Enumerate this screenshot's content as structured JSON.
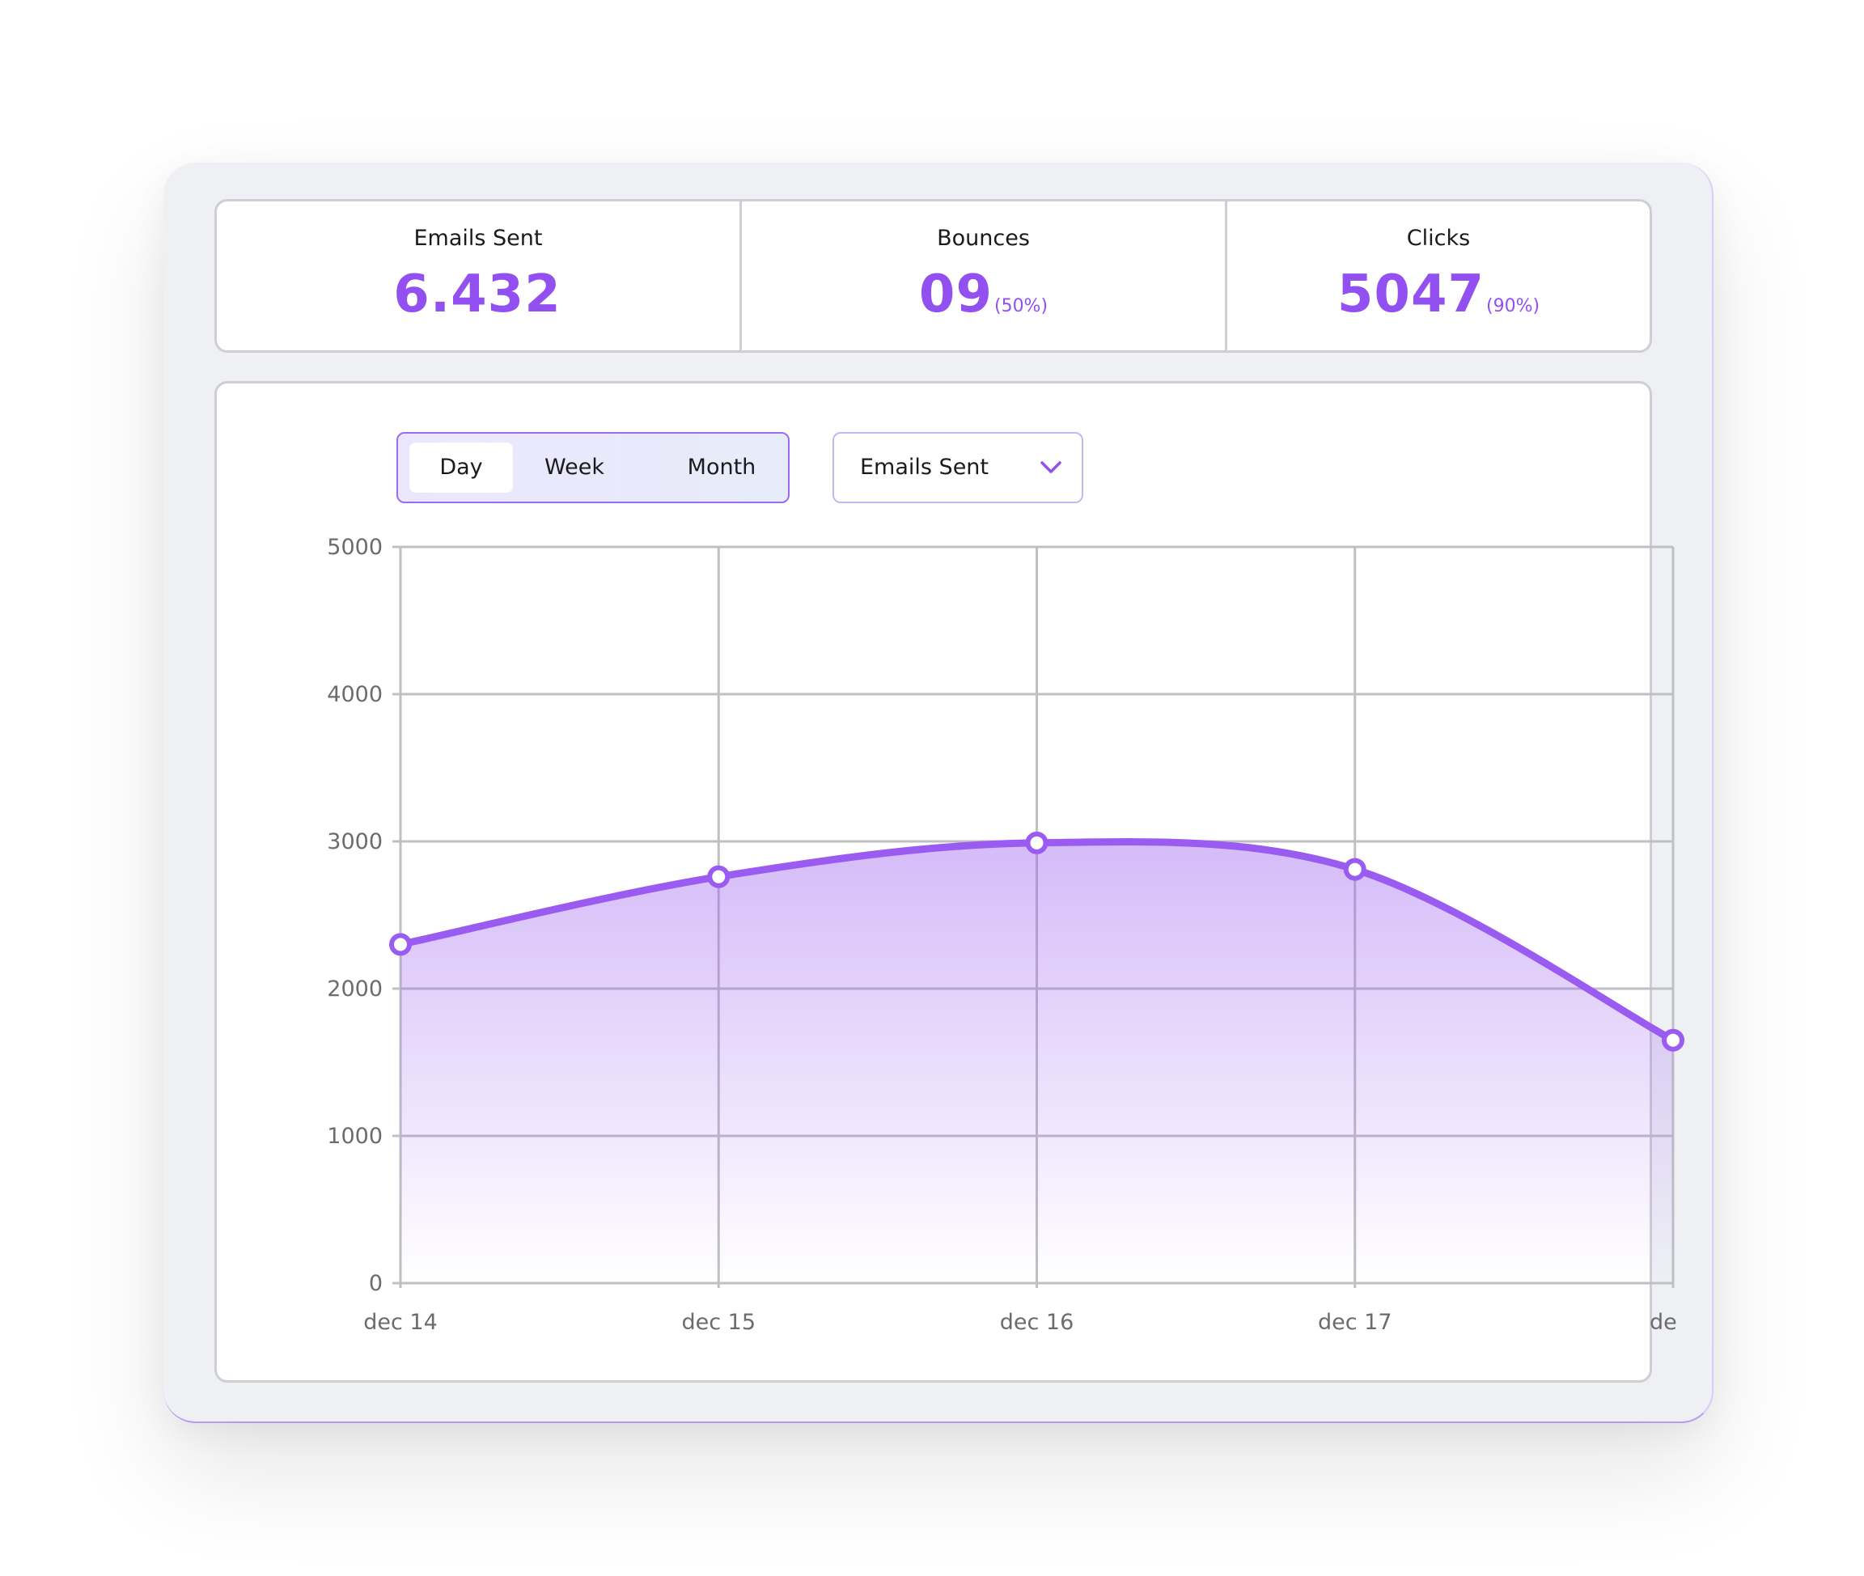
{
  "stats": [
    {
      "label": "Emails Sent",
      "value": "6.432",
      "pct": ""
    },
    {
      "label": "Bounces",
      "value": "09",
      "pct": "(50%)"
    },
    {
      "label": "Clicks",
      "value": "5047",
      "pct": "(90%)"
    }
  ],
  "controls": {
    "range_options": [
      "Day",
      "Week",
      "Month"
    ],
    "range_selected": "Day",
    "metric_selected": "Emails Sent"
  },
  "colors": {
    "accent": "#9250f0",
    "line": "#9a5cf0",
    "grid": "#bfbfc4"
  },
  "chart_data": {
    "type": "area",
    "x": [
      "dec 14",
      "dec 15",
      "dec 16",
      "dec 17",
      "de"
    ],
    "series": [
      {
        "values": [
          2300,
          2760,
          2990,
          2810,
          1650
        ]
      }
    ],
    "ylim": [
      0,
      5000
    ],
    "yticks": [
      0,
      1000,
      2000,
      3000,
      4000,
      5000
    ],
    "grid": true
  }
}
